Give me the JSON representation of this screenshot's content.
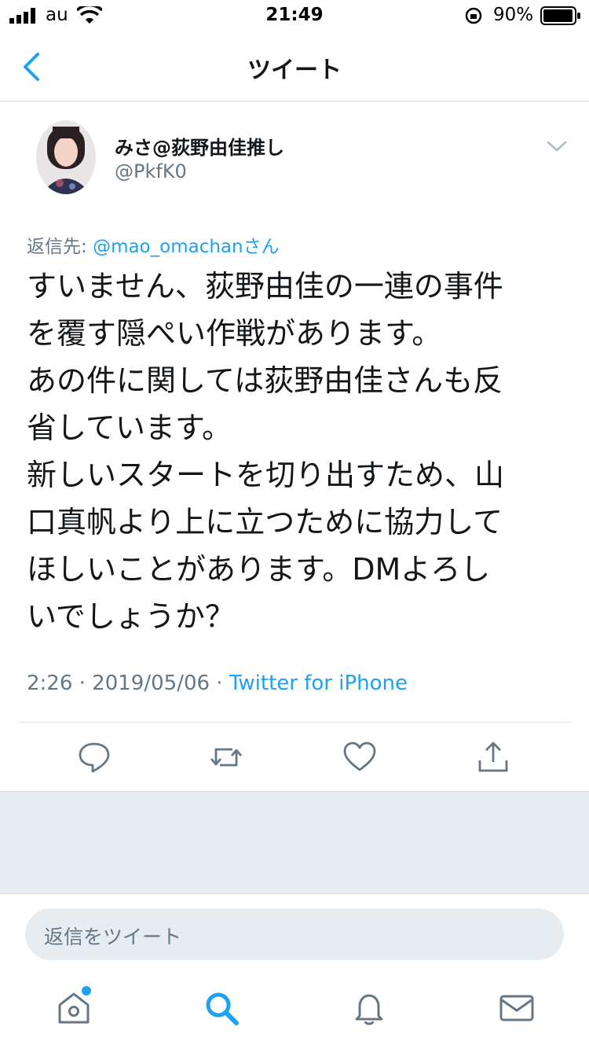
{
  "status_bar": {
    "carrier": "au",
    "time": "21:49",
    "battery": "90%"
  },
  "nav": {
    "back_icon": "chevron-left-icon",
    "title": "ツイート"
  },
  "tweet": {
    "display_name": "みさ@荻野由佳推し",
    "handle": "@PkfK0",
    "reply_to_label": "返信先: ",
    "reply_to_user": "@mao_omachanさん",
    "text": "すいません、荻野由佳の一連の事件\nを覆す隠ぺい作戦があります。\nあの件に関しては荻野由佳さんも反\n省しています。\n新しいスタートを切り出すため、山\n口真帆より上に立つために協力して\nほしいことがあります。DMよろし\nいでしょうか？",
    "timestamp": "2:26 · 2019/05/06 · ",
    "source": "Twitter for iPhone"
  },
  "reply": {
    "placeholder": "返信をツイート"
  },
  "colors": {
    "accent": "#1da1f2",
    "secondary_text": "#657786",
    "background_gray": "#e6ecf0"
  }
}
